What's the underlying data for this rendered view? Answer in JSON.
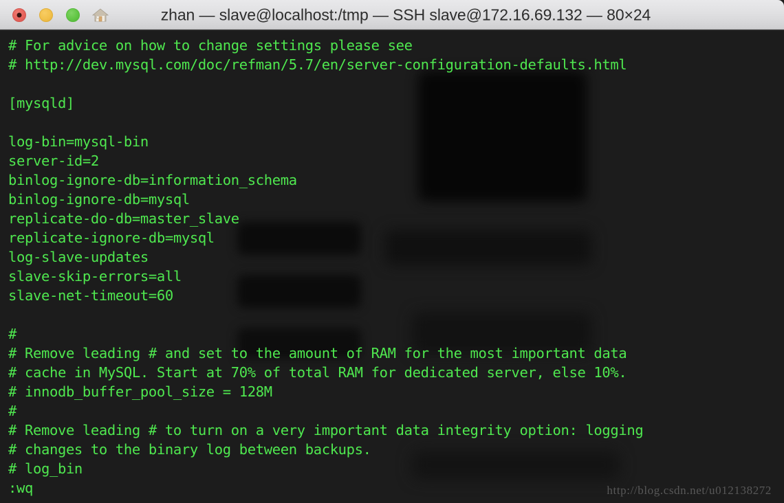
{
  "window": {
    "title": "zhan — slave@localhost:/tmp — SSH slave@172.16.69.132 — 80×24",
    "traffic_lights": [
      {
        "name": "close",
        "color": "#e8635c"
      },
      {
        "name": "minimize",
        "color": "#f2c14b"
      },
      {
        "name": "zoom",
        "color": "#62c645"
      }
    ],
    "proxy_icon": "house-icon"
  },
  "terminal": {
    "foreground_color": "#4fe84f",
    "background_color": "#1c1c1c",
    "columns": 80,
    "rows": 24,
    "lines": [
      "# For advice on how to change settings please see",
      "# http://dev.mysql.com/doc/refman/5.7/en/server-configuration-defaults.html",
      "",
      "[mysqld]",
      "",
      "log-bin=mysql-bin",
      "server-id=2",
      "binlog-ignore-db=information_schema",
      "binlog-ignore-db=mysql",
      "replicate-do-db=master_slave",
      "replicate-ignore-db=mysql",
      "log-slave-updates",
      "slave-skip-errors=all",
      "slave-net-timeout=60",
      "",
      "#",
      "# Remove leading # and set to the amount of RAM for the most important data",
      "# cache in MySQL. Start at 70% of total RAM for dedicated server, else 10%.",
      "# innodb_buffer_pool_size = 128M",
      "#",
      "# Remove leading # to turn on a very important data integrity option: logging",
      "# changes to the binary log between backups.",
      "# log_bin",
      ":wq"
    ]
  },
  "watermark": {
    "text": "http://blog.csdn.net/u012138272"
  }
}
